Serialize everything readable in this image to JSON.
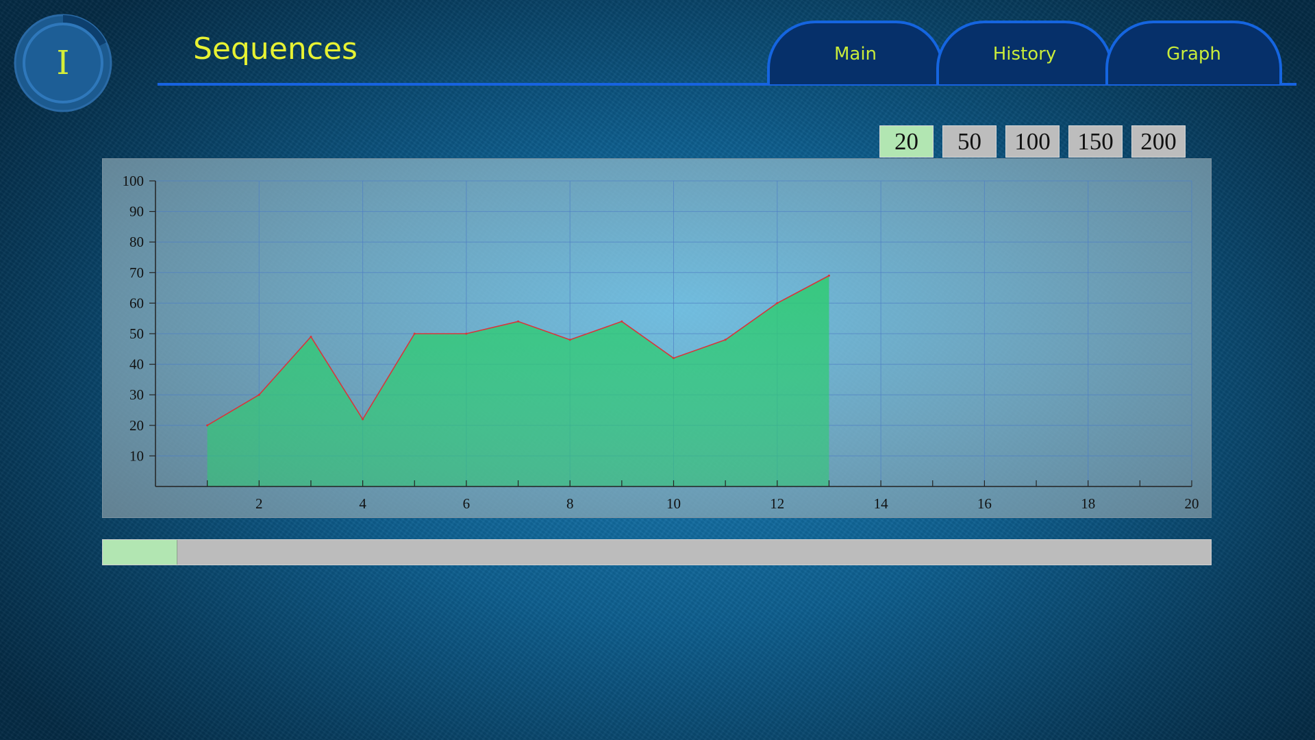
{
  "logo": {
    "letter": "I"
  },
  "page_title": "Sequences",
  "tabs": [
    {
      "label": "Main"
    },
    {
      "label": "History"
    },
    {
      "label": "Graph"
    }
  ],
  "range_buttons": [
    {
      "label": "20",
      "active": true
    },
    {
      "label": "50",
      "active": false
    },
    {
      "label": "100",
      "active": false
    },
    {
      "label": "150",
      "active": false
    },
    {
      "label": "200",
      "active": false
    }
  ],
  "colors": {
    "accent_yellow": "#e7f233",
    "tab_border": "#1565e0",
    "tab_fill": "#06306a",
    "selected_button": "#b2e6b2",
    "area_fill": "#2ecc71",
    "line": "#d9343a",
    "grid": "#4f7fc4"
  },
  "chart_data": {
    "type": "area",
    "x": [
      1,
      2,
      3,
      4,
      5,
      6,
      7,
      8,
      9,
      10,
      11,
      12,
      13
    ],
    "series": [
      {
        "values": [
          20,
          30,
          49,
          22,
          50,
          50,
          54,
          48,
          54,
          42,
          48,
          60,
          69
        ]
      }
    ],
    "xlim": [
      0,
      20
    ],
    "ylim": [
      0,
      100
    ],
    "x_ticks": [
      2,
      4,
      6,
      8,
      10,
      12,
      14,
      16,
      18,
      20
    ],
    "y_ticks": [
      10,
      20,
      30,
      40,
      50,
      60,
      70,
      80,
      90,
      100
    ],
    "xlabel": "",
    "ylabel": "",
    "grid": true
  },
  "progress": {
    "fraction": 0.067
  }
}
